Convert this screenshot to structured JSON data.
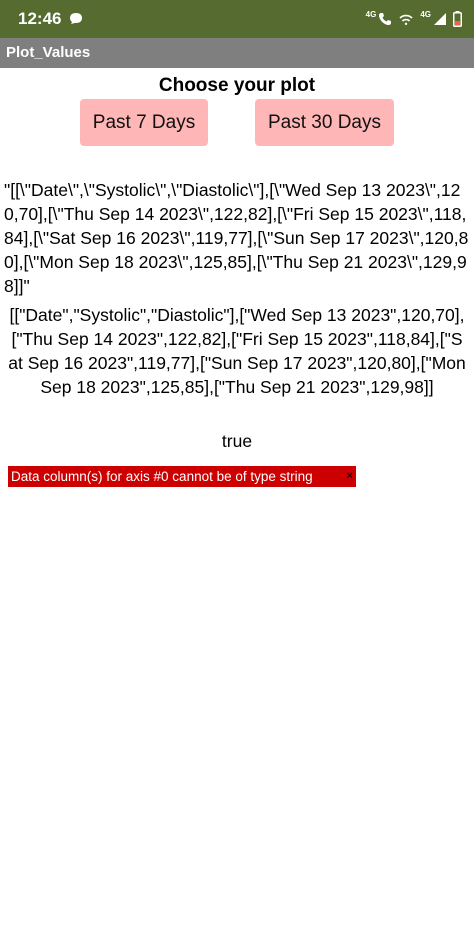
{
  "status_bar": {
    "time": "12:46",
    "network_label_1": "4G",
    "network_label_2": "4G",
    "background_color": "#556b2f",
    "icons": [
      "message-icon",
      "call-icon",
      "wifi-icon",
      "signal-icon",
      "battery-icon"
    ]
  },
  "app_bar": {
    "title": "Plot_Values",
    "background_color": "#7f7f7f"
  },
  "main": {
    "heading": "Choose your plot",
    "buttons": {
      "past_7_days": "Past 7 Days",
      "past_30_days": "Past 30 Days"
    },
    "button_color": "#ffb6b6",
    "raw_json_string": "\"[[\\\"Date\\\",\\\"Systolic\\\",\\\"Diastolic\\\"],[\\\"Wed Sep 13 2023\\\",120,70],[\\\"Thu Sep 14 2023\\\",122,82],[\\\"Fri Sep 15 2023\\\",118,84],[\\\"Sat Sep 16 2023\\\",119,77],[\\\"Sun Sep 17 2023\\\",120,80],[\\\"Mon Sep 18 2023\\\",125,85],[\\\"Thu Sep 21 2023\\\",129,98]]\"",
    "parsed_array_string": "[[\"Date\",\"Systolic\",\"Diastolic\"],[\"Wed Sep 13 2023\",120,70],[\"Thu Sep 14 2023\",122,82],[\"Fri Sep 15 2023\",118,84],[\"Sat Sep 16 2023\",119,77],[\"Sun Sep 17 2023\",120,80],[\"Mon Sep 18 2023\",125,85],[\"Thu Sep 21 2023\",129,98]]",
    "bool_value": "true",
    "error": {
      "message": "Data column(s) for axis #0 cannot be of type string",
      "close_symbol": "×",
      "color": "#cc0000"
    }
  }
}
